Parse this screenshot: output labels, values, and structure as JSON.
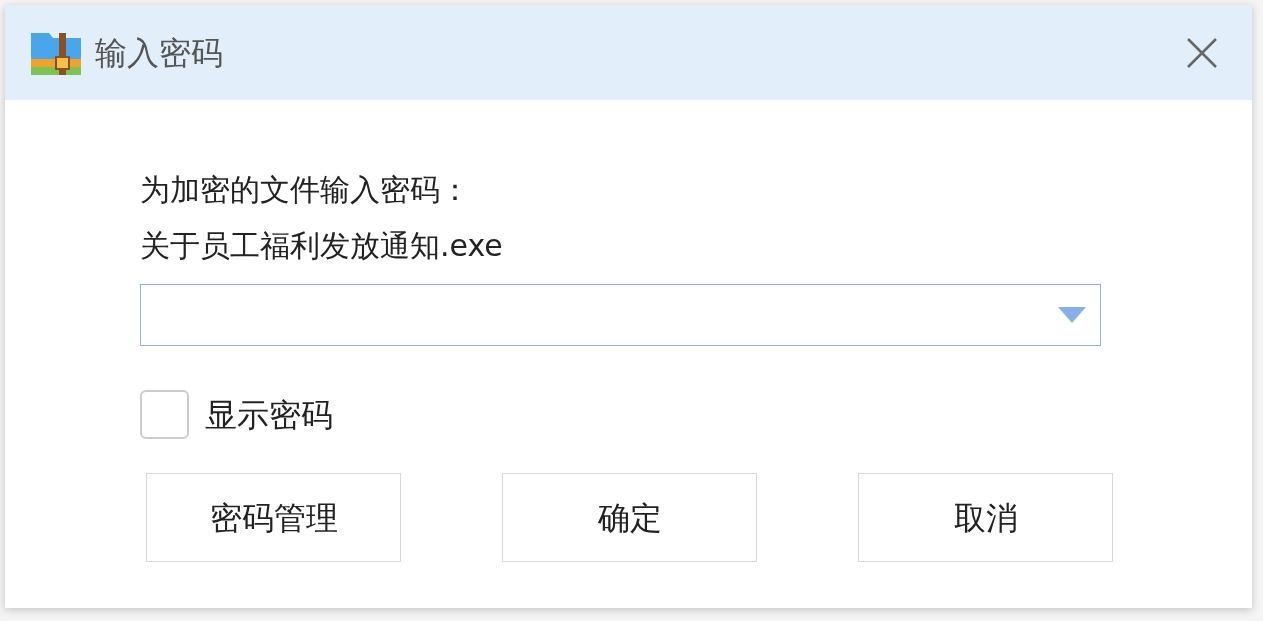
{
  "window": {
    "title": "输入密码"
  },
  "prompt": "为加密的文件输入密码：",
  "file_name": "关于员工福利发放通知.exe",
  "password_field": {
    "expanded": false
  },
  "show_password": {
    "label": "显示密码",
    "checked": false
  },
  "buttons": [
    {
      "label": "密码管理"
    },
    {
      "label": "确定"
    },
    {
      "label": "取消"
    }
  ]
}
